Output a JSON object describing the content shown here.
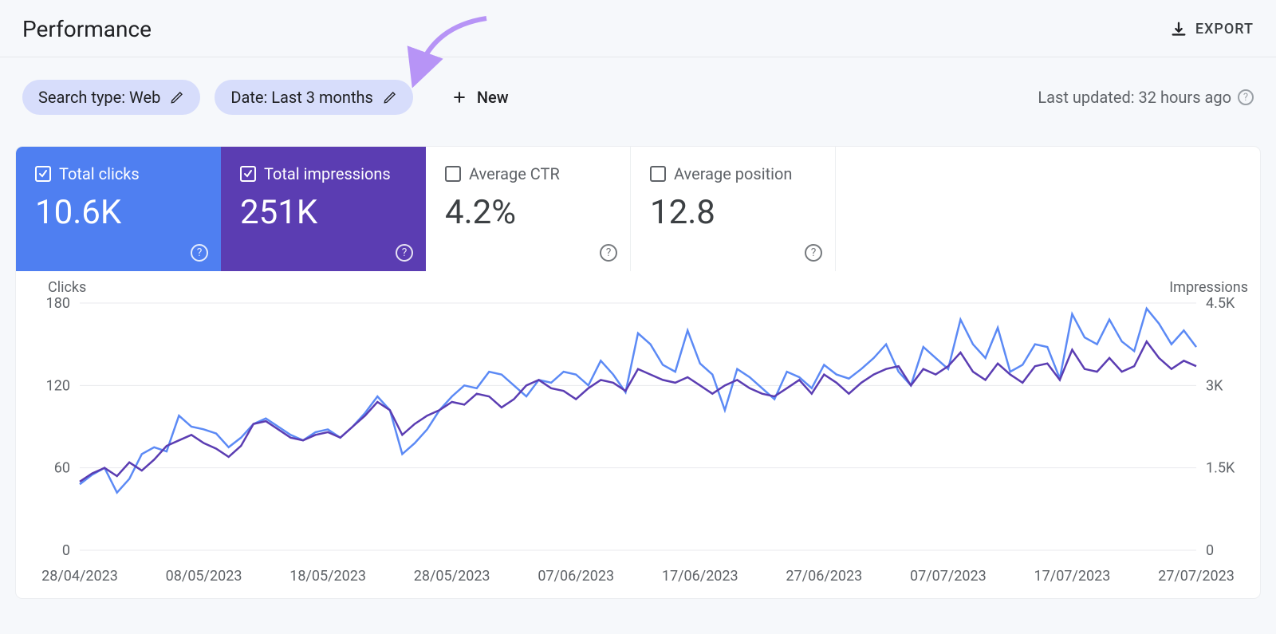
{
  "header": {
    "title": "Performance",
    "export_label": "EXPORT"
  },
  "filters": {
    "search_type_chip": "Search type: Web",
    "date_chip": "Date: Last 3 months",
    "new_label": "New",
    "last_updated": "Last updated: 32 hours ago"
  },
  "metrics": [
    {
      "label": "Total clicks",
      "value": "10.6K",
      "checked": true,
      "variant": "blue"
    },
    {
      "label": "Total impressions",
      "value": "251K",
      "checked": true,
      "variant": "purple"
    },
    {
      "label": "Average CTR",
      "value": "4.2%",
      "checked": false,
      "variant": "plain"
    },
    {
      "label": "Average position",
      "value": "12.8",
      "checked": false,
      "variant": "plain"
    }
  ],
  "chart_data": {
    "type": "line",
    "left_axis_label": "Clicks",
    "right_axis_label": "Impressions",
    "left_ticks": [
      0,
      60,
      120,
      180
    ],
    "right_ticks": [
      "0",
      "1.5K",
      "3K",
      "4.5K"
    ],
    "ylim_clicks": [
      0,
      180
    ],
    "ylim_impressions": [
      0,
      4500
    ],
    "x_tick_labels": [
      "28/04/2023",
      "08/05/2023",
      "18/05/2023",
      "28/05/2023",
      "07/06/2023",
      "17/06/2023",
      "27/06/2023",
      "07/07/2023",
      "17/07/2023",
      "27/07/2023"
    ],
    "series": [
      {
        "name": "Clicks",
        "axis": "left",
        "color": "#5c8af5",
        "values": [
          48,
          55,
          60,
          42,
          52,
          70,
          75,
          72,
          98,
          90,
          88,
          85,
          75,
          82,
          92,
          96,
          90,
          84,
          80,
          86,
          88,
          82,
          90,
          100,
          112,
          102,
          70,
          78,
          88,
          102,
          112,
          120,
          118,
          130,
          128,
          120,
          112,
          124,
          122,
          130,
          128,
          120,
          138,
          128,
          115,
          158,
          150,
          135,
          130,
          160,
          136,
          128,
          102,
          132,
          126,
          118,
          110,
          130,
          126,
          118,
          135,
          128,
          125,
          132,
          140,
          150,
          130,
          120,
          148,
          140,
          132,
          168,
          150,
          140,
          162,
          130,
          135,
          150,
          148,
          125,
          172,
          155,
          150,
          168,
          152,
          145,
          176,
          165,
          150,
          160,
          148
        ]
      },
      {
        "name": "Impressions",
        "axis": "right",
        "color": "#5b3db2",
        "values": [
          1250,
          1400,
          1500,
          1350,
          1600,
          1450,
          1650,
          1900,
          2000,
          2100,
          1950,
          1850,
          1700,
          1900,
          2300,
          2350,
          2200,
          2050,
          2000,
          2100,
          2150,
          2050,
          2250,
          2450,
          2700,
          2550,
          2100,
          2300,
          2450,
          2550,
          2700,
          2650,
          2850,
          2800,
          2600,
          2750,
          3000,
          3100,
          2950,
          2900,
          2750,
          2950,
          3100,
          3050,
          2900,
          3300,
          3200,
          3100,
          3050,
          3150,
          3000,
          2850,
          3000,
          3100,
          2950,
          2850,
          2800,
          2950,
          3100,
          2850,
          3200,
          3050,
          2850,
          3050,
          3200,
          3300,
          3350,
          3000,
          3300,
          3200,
          3350,
          3600,
          3250,
          3100,
          3400,
          3200,
          3050,
          3350,
          3400,
          3100,
          3650,
          3300,
          3250,
          3500,
          3250,
          3350,
          3800,
          3500,
          3300,
          3450,
          3350
        ]
      }
    ]
  }
}
